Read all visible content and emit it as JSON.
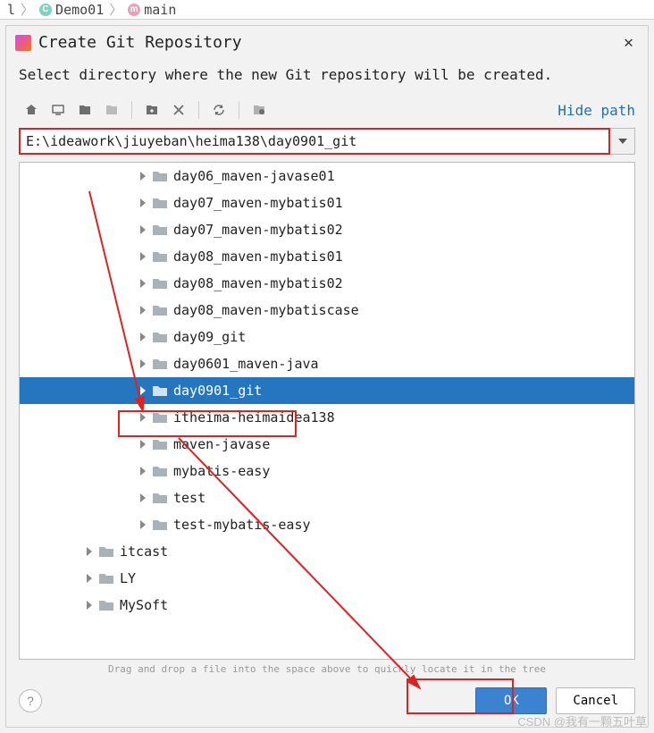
{
  "breadcrumb": {
    "item1_badge": "C",
    "item1_label": "Demo01",
    "item2_badge": "m",
    "item2_label": "main"
  },
  "dialog": {
    "title": "Create Git Repository",
    "subtitle": "Select directory where the new Git repository will be created.",
    "hide_path_label": "Hide path",
    "path_value": "E:\\ideawork\\jiuyeban\\heima138\\day0901_git",
    "tree_hint": "Drag and drop a file into the space above to quickly locate it in the tree",
    "ok_label": "OK",
    "cancel_label": "Cancel"
  },
  "toolbar": {
    "home_title": "Home",
    "desktop_title": "Desktop",
    "project_title": "Project",
    "module_title": "Module",
    "newfolder_title": "New Folder",
    "delete_title": "Delete",
    "refresh_title": "Refresh",
    "showhidden_title": "Show Hidden"
  },
  "tree": [
    {
      "label": "day06_maven-javase01",
      "depth": 4,
      "selected": false
    },
    {
      "label": "day07_maven-mybatis01",
      "depth": 4,
      "selected": false
    },
    {
      "label": "day07_maven-mybatis02",
      "depth": 4,
      "selected": false
    },
    {
      "label": "day08_maven-mybatis01",
      "depth": 4,
      "selected": false
    },
    {
      "label": "day08_maven-mybatis02",
      "depth": 4,
      "selected": false
    },
    {
      "label": "day08_maven-mybatiscase",
      "depth": 4,
      "selected": false
    },
    {
      "label": "day09_git",
      "depth": 4,
      "selected": false
    },
    {
      "label": "day0601_maven-java",
      "depth": 4,
      "selected": false
    },
    {
      "label": "day0901_git",
      "depth": 4,
      "selected": true
    },
    {
      "label": "itheima-heimaidea138",
      "depth": 4,
      "selected": false
    },
    {
      "label": "maven-javase",
      "depth": 4,
      "selected": false
    },
    {
      "label": "mybatis-easy",
      "depth": 4,
      "selected": false
    },
    {
      "label": "test",
      "depth": 4,
      "selected": false
    },
    {
      "label": "test-mybatis-easy",
      "depth": 4,
      "selected": false
    },
    {
      "label": "itcast",
      "depth": 2,
      "selected": false
    },
    {
      "label": "LY",
      "depth": 2,
      "selected": false
    },
    {
      "label": "MySoft",
      "depth": 2,
      "selected": false
    }
  ],
  "watermark": "CSDN @我有一颗五叶草"
}
